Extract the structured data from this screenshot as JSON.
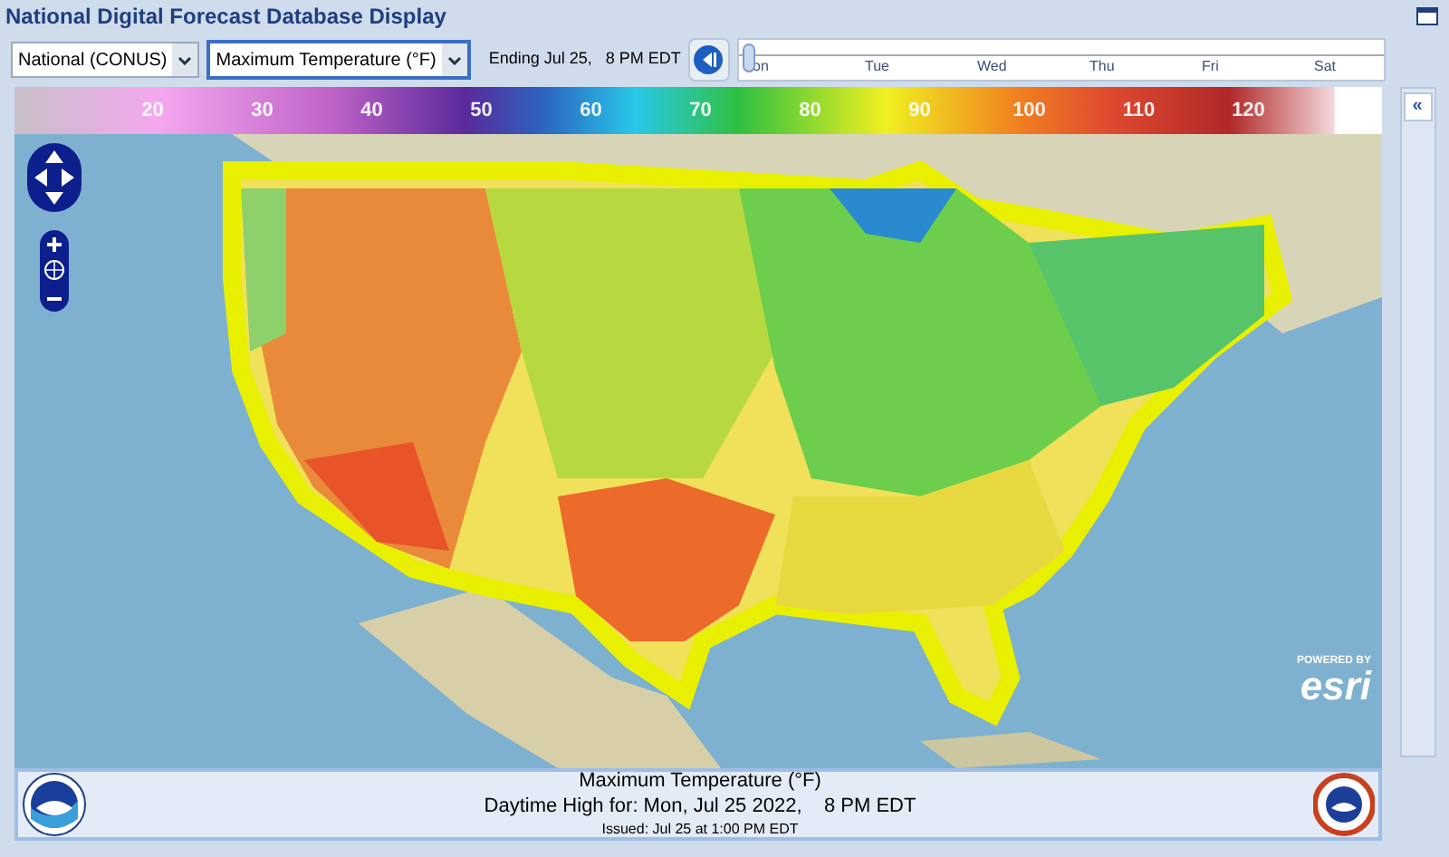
{
  "window": {
    "title": "National Digital Forecast Database Display"
  },
  "controls": {
    "region": "National (CONUS)",
    "element": "Maximum Temperature (°F)",
    "ending": "Ending Jul 25,   8 PM EDT"
  },
  "timeline": {
    "days": [
      "on",
      "Tue",
      "Wed",
      "Thu",
      "Fri",
      "Sat"
    ]
  },
  "legend": {
    "labels": [
      "20",
      "30",
      "40",
      "50",
      "60",
      "70",
      "80",
      "90",
      "100",
      "110",
      "120"
    ]
  },
  "side_panel": {
    "collapse_label": "«"
  },
  "map": {
    "kind": "picture",
    "attribution": {
      "line_1": "POWERED BY",
      "line_2": "esri"
    }
  },
  "footer": {
    "title": "Maximum Temperature (°F)",
    "subtitle": "Daytime High for: Mon, Jul 25 2022,    8 PM EDT",
    "issued": "Issued: Jul 25 at 1:00 PM EDT"
  }
}
